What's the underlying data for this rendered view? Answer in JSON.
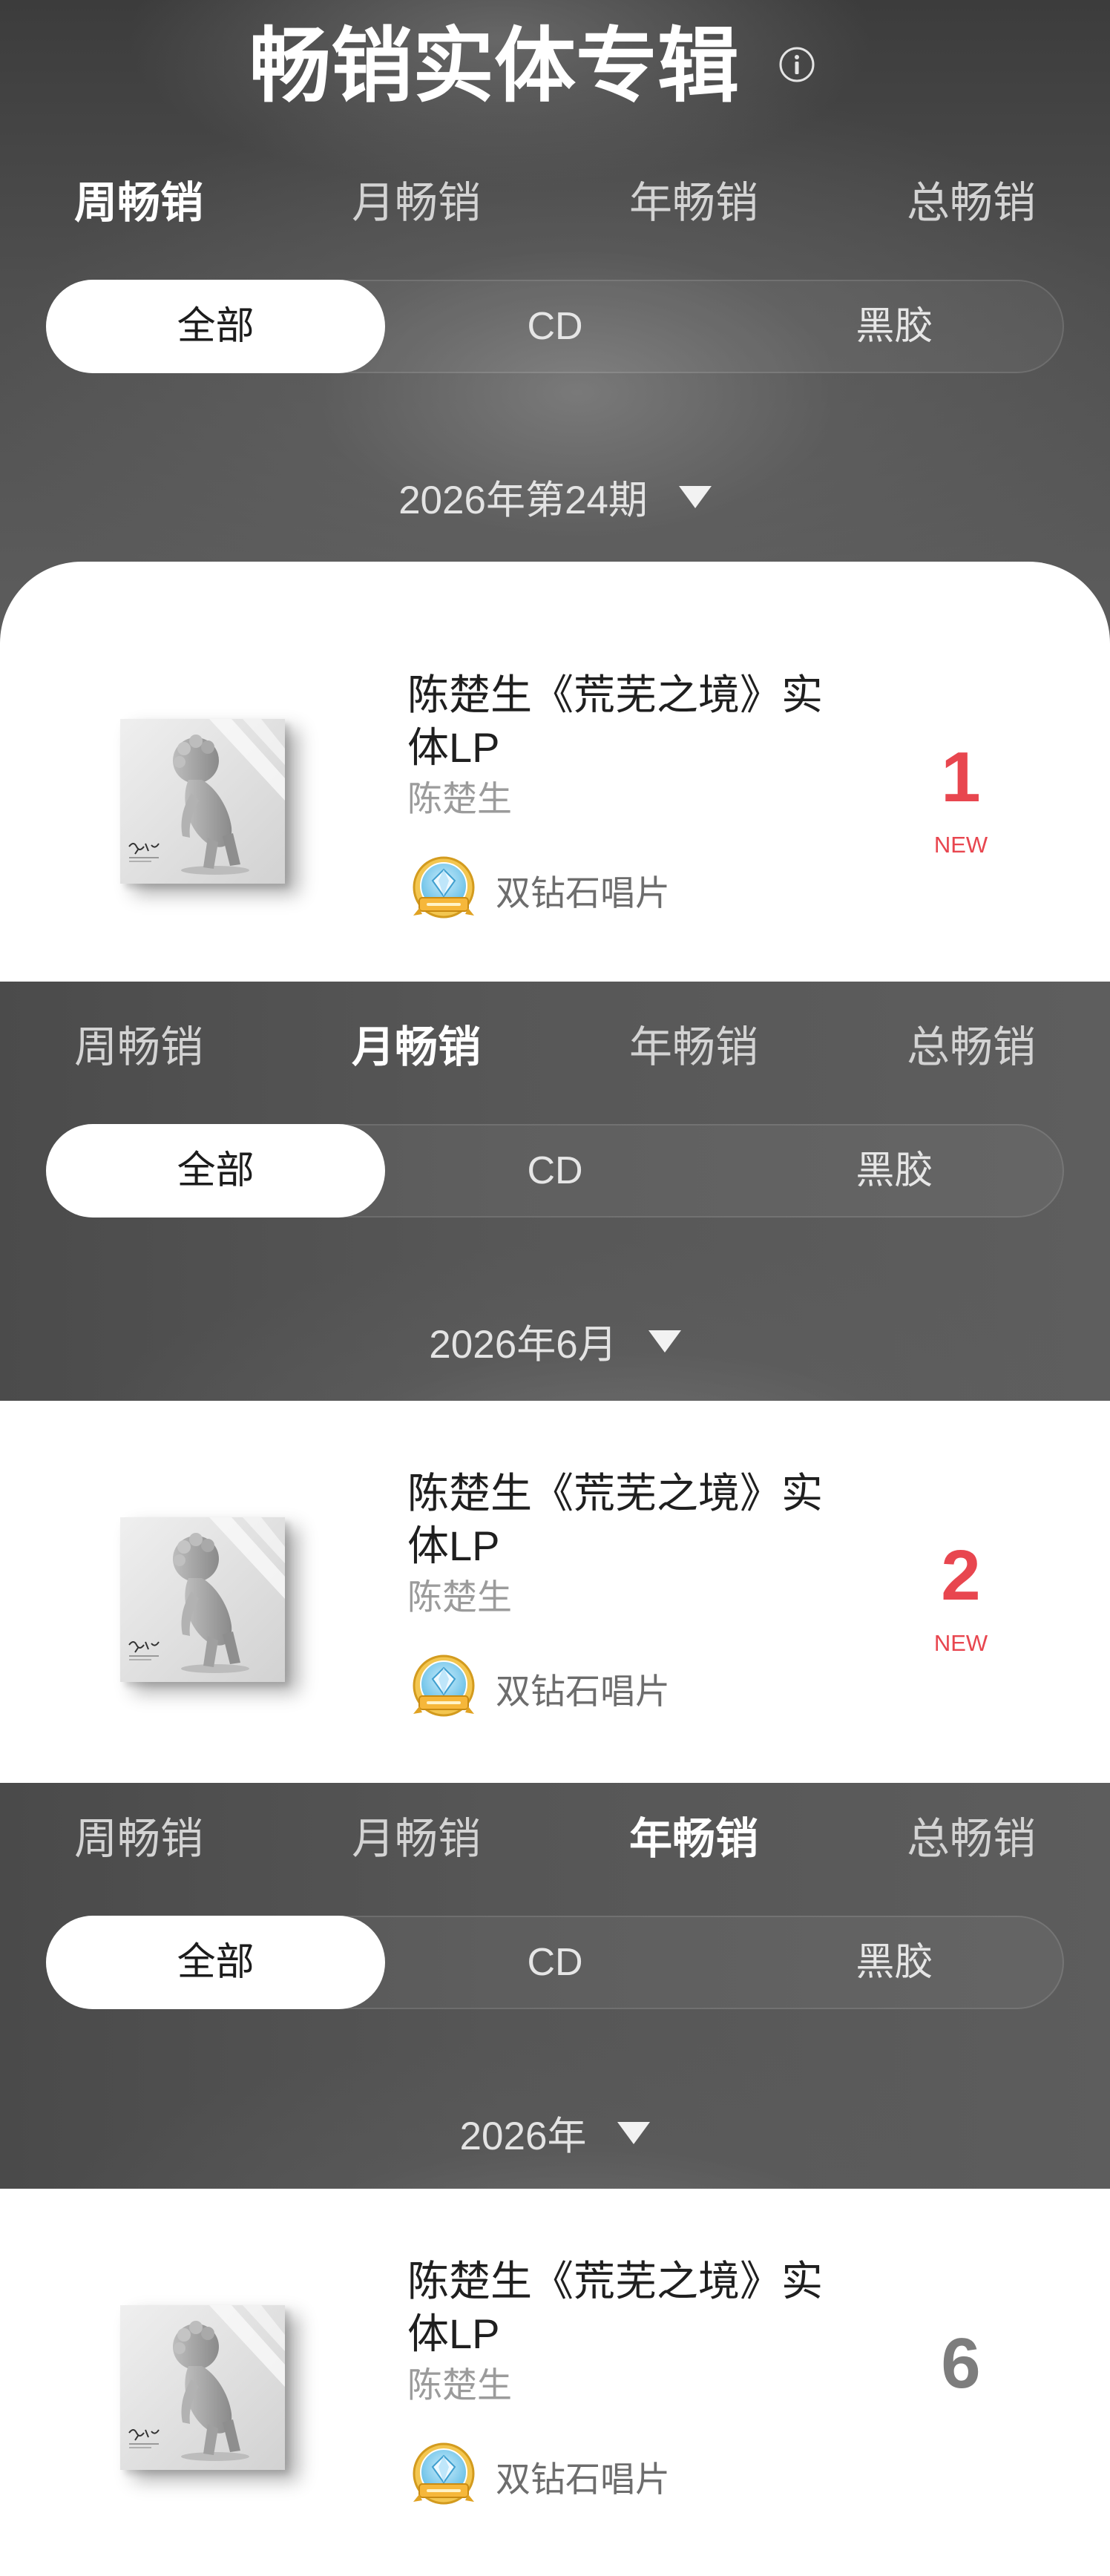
{
  "header": {
    "title": "畅销实体专辑",
    "info_icon": "info-icon"
  },
  "sections": [
    {
      "tabs": [
        {
          "label": "周畅销",
          "active": true
        },
        {
          "label": "月畅销",
          "active": false
        },
        {
          "label": "年畅销",
          "active": false
        },
        {
          "label": "总畅销",
          "active": false
        }
      ],
      "filters": [
        {
          "label": "全部",
          "active": true
        },
        {
          "label": "CD",
          "active": false
        },
        {
          "label": "黑胶",
          "active": false
        }
      ],
      "period": "2026年第24期",
      "period_icon": "chevron-down-icon",
      "album": {
        "title": "陈楚生《荒芜之境》实体LP",
        "artist": "陈楚生",
        "certification": "双钻石唱片",
        "certification_icon": "double-diamond-badge-icon",
        "rank": "1",
        "rank_color": "#e8464f",
        "tag": "NEW"
      }
    },
    {
      "tabs": [
        {
          "label": "周畅销",
          "active": false
        },
        {
          "label": "月畅销",
          "active": true
        },
        {
          "label": "年畅销",
          "active": false
        },
        {
          "label": "总畅销",
          "active": false
        }
      ],
      "filters": [
        {
          "label": "全部",
          "active": true
        },
        {
          "label": "CD",
          "active": false
        },
        {
          "label": "黑胶",
          "active": false
        }
      ],
      "period": "2026年6月",
      "period_icon": "chevron-down-icon",
      "album": {
        "title": "陈楚生《荒芜之境》实体LP",
        "artist": "陈楚生",
        "certification": "双钻石唱片",
        "certification_icon": "double-diamond-badge-icon",
        "rank": "2",
        "rank_color": "#e8464f",
        "tag": "NEW"
      }
    },
    {
      "tabs": [
        {
          "label": "周畅销",
          "active": false
        },
        {
          "label": "月畅销",
          "active": false
        },
        {
          "label": "年畅销",
          "active": true
        },
        {
          "label": "总畅销",
          "active": false
        }
      ],
      "filters": [
        {
          "label": "全部",
          "active": true
        },
        {
          "label": "CD",
          "active": false
        },
        {
          "label": "黑胶",
          "active": false
        }
      ],
      "period": "2026年",
      "period_icon": "chevron-down-icon",
      "album": {
        "title": "陈楚生《荒芜之境》实体LP",
        "artist": "陈楚生",
        "certification": "双钻石唱片",
        "certification_icon": "double-diamond-badge-icon",
        "rank": "6",
        "rank_color": "#7d7d7d"
      }
    }
  ],
  "colors": {
    "background": "#555555",
    "card": "#ffffff",
    "accent": "#e8464f",
    "rank_muted": "#7d7d7d",
    "active_filter": "#ffffff"
  }
}
